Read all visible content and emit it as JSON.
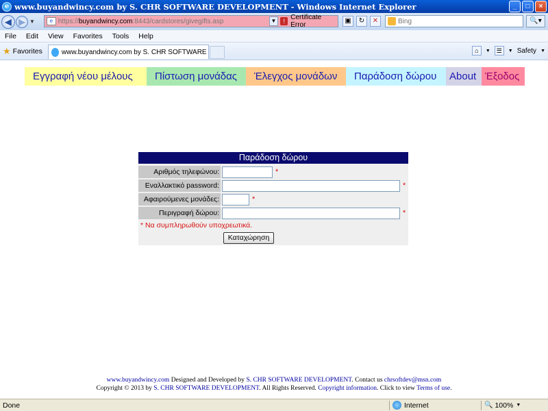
{
  "window": {
    "title": "www.buyandwincy.com by S. CHR SOFTWARE DEVELOPMENT - Windows Internet Explorer",
    "min_symbol": "_",
    "max_symbol": "□",
    "close_symbol": "×"
  },
  "address": {
    "url_prefix": "https://",
    "url_host": "buyandwincy.com",
    "url_path": ":8443/cardstores/givegifts.asp",
    "cert_error_label": "Certificate Error",
    "search_placeholder": "Bing"
  },
  "menu": [
    "File",
    "Edit",
    "View",
    "Favorites",
    "Tools",
    "Help"
  ],
  "favorites_bar": {
    "favorites_label": "Favorites",
    "tab_title": "www.buyandwincy.com by S. CHR SOFTWARE DEVEL...",
    "safety_label": "Safety"
  },
  "nav": {
    "register": "Εγγραφή νέου μέλους",
    "credit": "Πίστωση μονάδας",
    "check": "Έλεγχος μονάδων",
    "gift": "Παράδοση δώρου",
    "about": "About",
    "exit": "Έξοδος"
  },
  "form": {
    "header": "Παράδοση δώρου",
    "phone_label": "Αριθμός τηλεφώνου:",
    "alt_password_label": "Εναλλακτικό password:",
    "units_label": "Αφαιρούμενες μονάδες:",
    "gift_desc_label": "Περιγραφή δώρου:",
    "required_mark": "*",
    "required_note": "* Να συμπληρωθούν υποχρεωτικά.",
    "submit_label": "Καταχώρηση"
  },
  "footer": {
    "site": "www.buyandwincy.com",
    "designed": " Designed and Developed by ",
    "company": "S. CHR SOFTWARE DEVELOPMENT",
    "contact": ". Contact us ",
    "email": "chrsoftdev@msn.com",
    "copyright": "Copyright © 2013 by ",
    "rights": ". All Rights Reserved. ",
    "copyright_info": "Copyright information",
    "click": ". Click to view ",
    "terms": "Terms of use",
    "dot": "."
  },
  "status": {
    "text": "Done",
    "zone": "Internet",
    "zoom": "100%"
  }
}
